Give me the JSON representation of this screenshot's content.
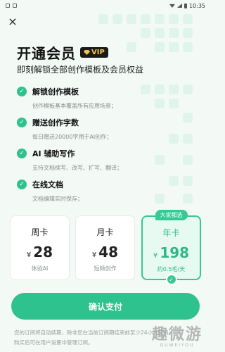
{
  "status_bar": {
    "time": "10:35"
  },
  "header": {
    "close_icon": "×",
    "title": "开通会员",
    "vip_label": "VIP",
    "subtitle": "即刻解锁全部创作模板及会员权益"
  },
  "features": [
    {
      "title": "解锁创作模板",
      "desc": "创作模板基本覆盖所有应用场景；"
    },
    {
      "title": "赠送创作字数",
      "desc": "每日赠送20000字用于AI创作；"
    },
    {
      "title": "AI 辅助写作",
      "desc": "支持文档续写、改写、扩写、翻译；"
    },
    {
      "title": "在线文档",
      "desc": "文档编辑实时保存；"
    }
  ],
  "plans": [
    {
      "name": "周卡",
      "currency": "¥",
      "amount": "28",
      "note": "体验AI",
      "selected": false
    },
    {
      "name": "月卡",
      "currency": "¥",
      "amount": "48",
      "note": "短频创作",
      "selected": false
    },
    {
      "name": "年卡",
      "currency": "¥",
      "amount": "198",
      "note": "约0.5毛/天",
      "selected": true,
      "tag": "大家都选"
    }
  ],
  "confirm_label": "确认支付",
  "footer": {
    "line1": "您的订阅将自动续期，除非您在当前订阅期结束前至少24小时取消。",
    "line2": "购买后可在用户设置中管理订阅。"
  },
  "watermark": {
    "main": "趣微游",
    "sub": "QUWEIYOU"
  },
  "colors": {
    "accent": "#2ec28f",
    "accent_light": "#e6faf2",
    "background": "#f3faf6"
  }
}
